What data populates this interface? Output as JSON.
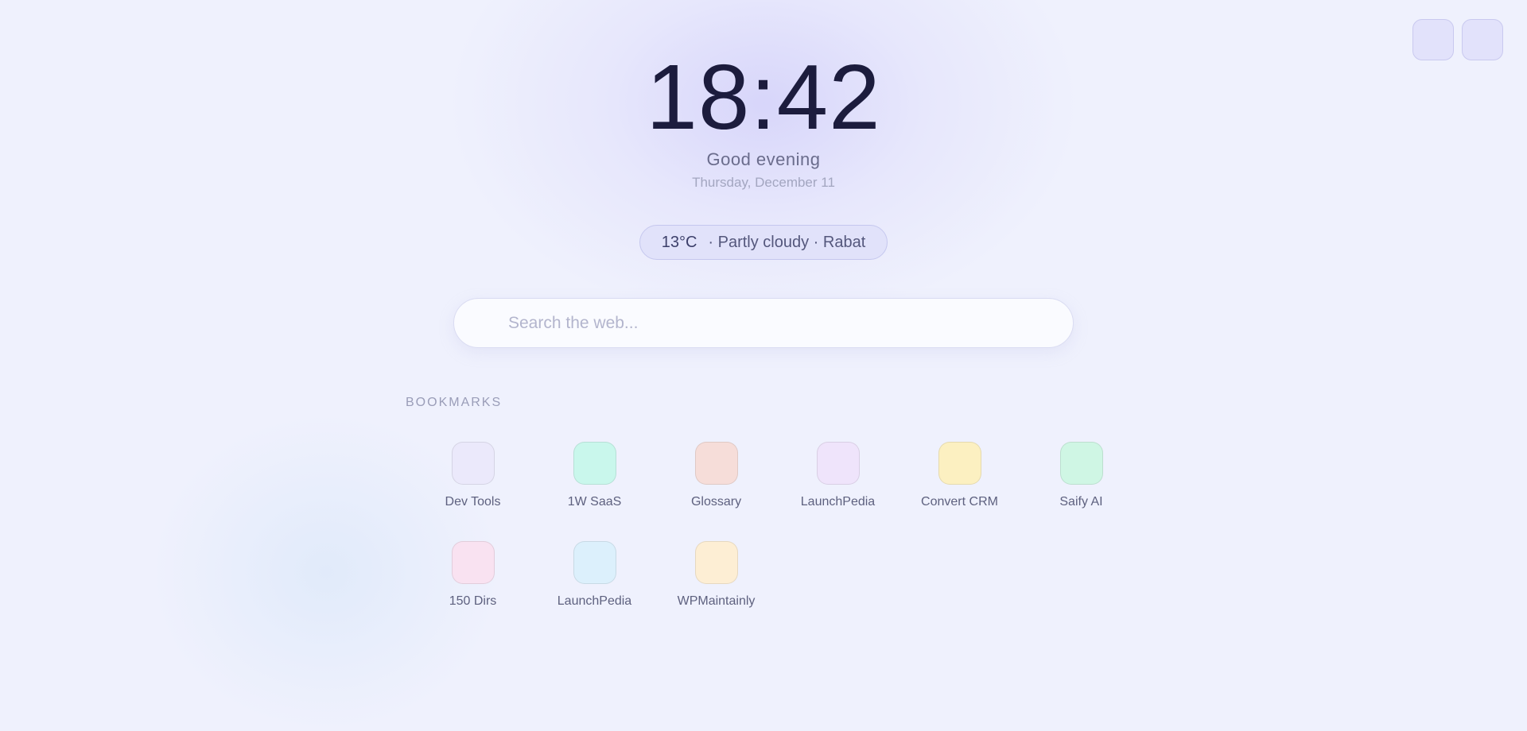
{
  "clock": {
    "time": "18:42"
  },
  "greeting": "Good evening",
  "date": "Thursday, December 11",
  "weather": {
    "temp": "13°C",
    "details": "· Partly cloudy · Rabat"
  },
  "search": {
    "placeholder": "Search the web..."
  },
  "bookmarks": {
    "title": "BOOKMARKS",
    "items": [
      {
        "label": "Dev Tools",
        "color": "#ebe9fb"
      },
      {
        "label": "1W SaaS",
        "color": "#c9f7ec"
      },
      {
        "label": "Glossary",
        "color": "#f6ddd9"
      },
      {
        "label": "LaunchPedia",
        "color": "#efe4fb"
      },
      {
        "label": "Convert CRM",
        "color": "#fcf0c1"
      },
      {
        "label": "Saify AI",
        "color": "#cff6e4"
      },
      {
        "label": "150 Dirs",
        "color": "#f9e2f1"
      },
      {
        "label": "LaunchPedia",
        "color": "#dcf0fc"
      },
      {
        "label": "WPMaintainly",
        "color": "#fdeed4"
      }
    ]
  },
  "colors": {
    "background": "#eff1fd",
    "accent": "#e1e2fa",
    "clock": "#1c1c3d"
  }
}
